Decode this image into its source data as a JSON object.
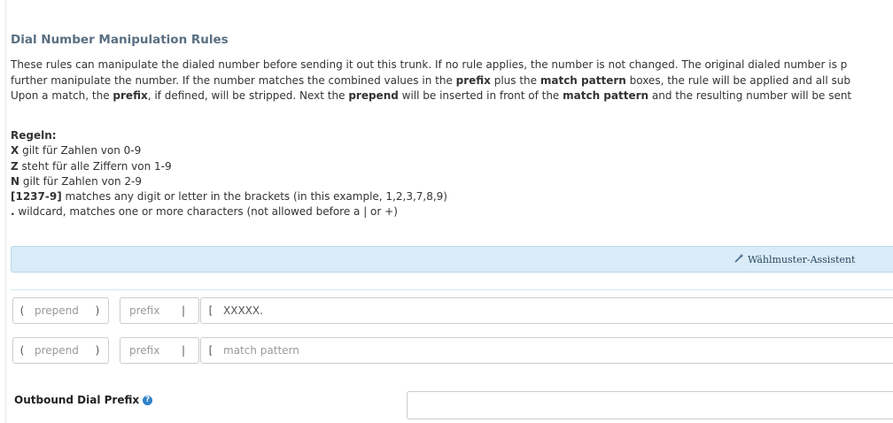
{
  "section_title": "Dial Number Manipulation Rules",
  "description": {
    "line1": "These rules can manipulate the dialed number before sending it out this trunk. If no rule applies, the number is not changed. The original dialed number is p",
    "line2_a": "further manipulate the number. If the number matches the combined values in the ",
    "line2_b": "prefix",
    "line2_c": " plus the ",
    "line2_d": "match pattern",
    "line2_e": " boxes, the rule will be applied and all sub",
    "line3_a": "Upon a match, the ",
    "line3_b": "prefix",
    "line3_c": ", if defined, will be stripped. Next the ",
    "line3_d": "prepend",
    "line3_e": " will be inserted in front of the ",
    "line3_f": "match pattern",
    "line3_g": " and the resulting number will be sent"
  },
  "rules": {
    "heading": "Regeln:",
    "items": [
      {
        "key": "X",
        "text": " gilt für Zahlen von 0-9"
      },
      {
        "key": "Z",
        "text": " steht für alle Ziffern von 1-9"
      },
      {
        "key": "N",
        "text": " gilt für Zahlen von 2-9"
      },
      {
        "key": "[1237-9]",
        "text": " matches any digit or letter in the brackets (in this example, 1,2,3,7,8,9)"
      },
      {
        "key": ".",
        "text": " wildcard, matches one or more characters (not allowed before a | or +)"
      }
    ]
  },
  "wizard": {
    "label": "Wählmuster-Assistent",
    "icon": "magic-wand-icon"
  },
  "pattern_rows": [
    {
      "open_paren": "(",
      "prepend_placeholder": "prepend",
      "close_paren": ")",
      "prefix_placeholder": "prefix",
      "pipe": "|",
      "open_bracket": "[",
      "match_value": "XXXXX.",
      "match_placeholder": "match pattern"
    },
    {
      "open_paren": "(",
      "prepend_placeholder": "prepend",
      "close_paren": ")",
      "prefix_placeholder": "prefix",
      "pipe": "|",
      "open_bracket": "[",
      "match_value": "",
      "match_placeholder": "match pattern"
    }
  ],
  "outbound": {
    "label": "Outbound Dial Prefix",
    "help_icon": "help-circle-icon",
    "value": ""
  },
  "colors": {
    "accent": "#2f82c8",
    "title": "#5a6f82",
    "wizard_bg": "#d9ecf8"
  }
}
